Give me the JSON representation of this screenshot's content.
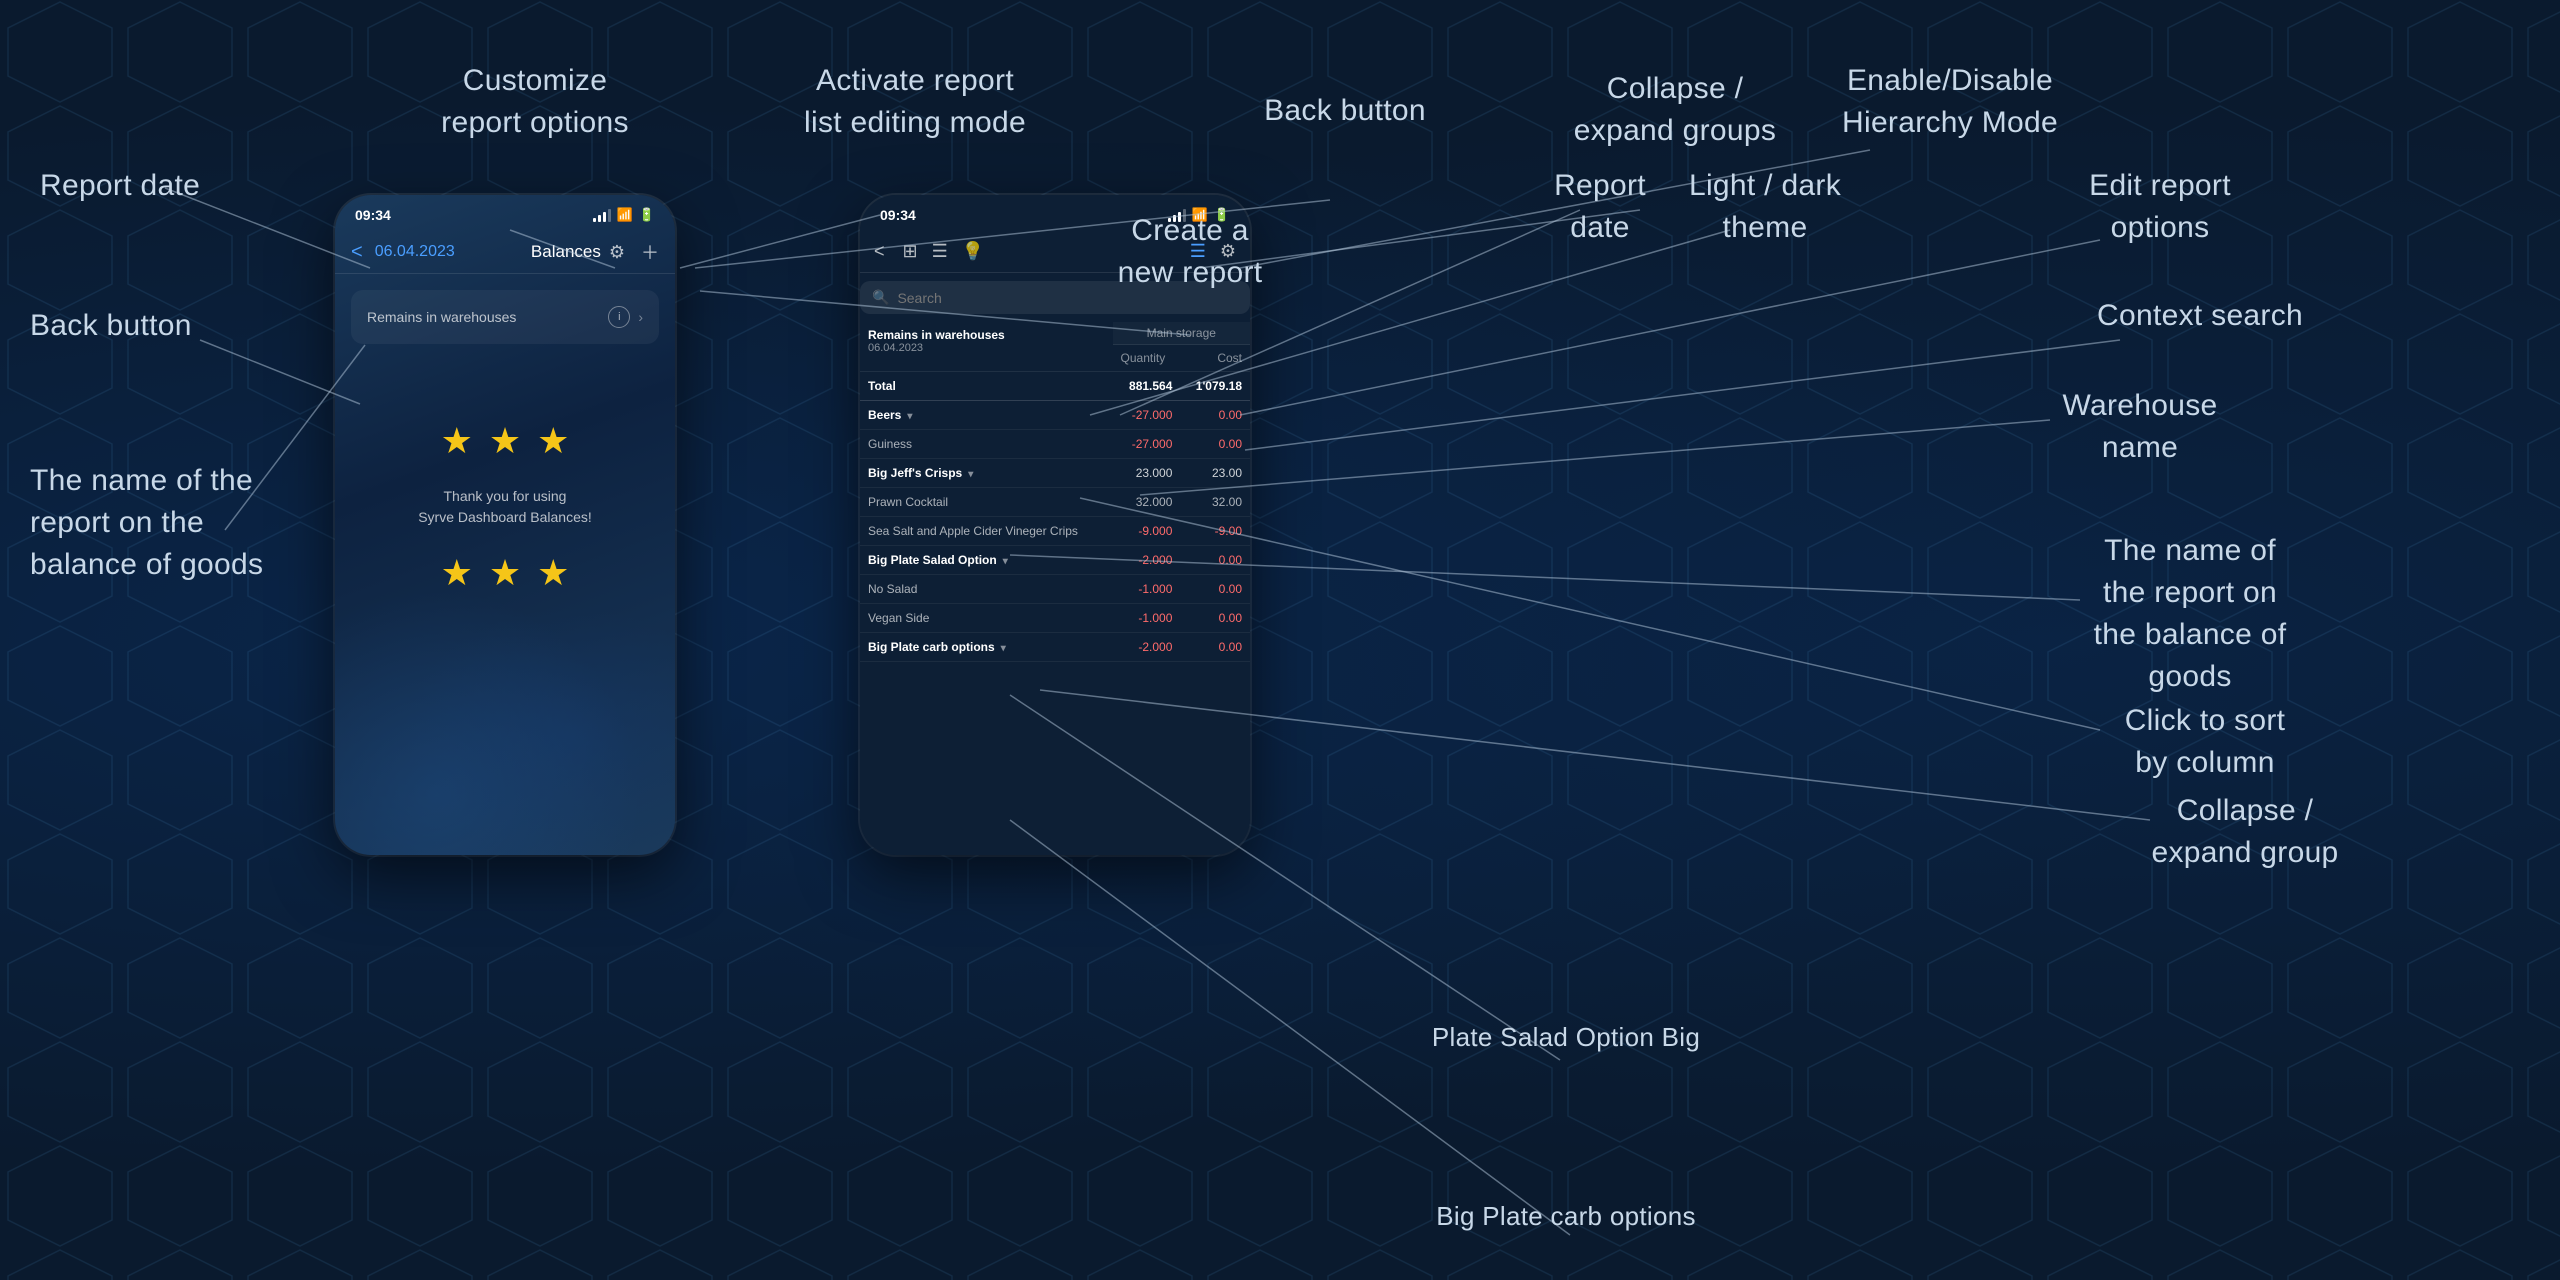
{
  "background": {
    "color": "#0a1a2e"
  },
  "annotations": {
    "customize_report": "Customize\nreport options",
    "activate_edit": "Activate report\nlist editing mode",
    "back_button_top": "Back button",
    "collapse_expand": "Collapse /\nexpand groups",
    "enable_disable": "Enable/Disable\nHierarchy Mode",
    "report_date_left": "Report date",
    "back_button_left": "Back button",
    "create_new": "Create a\nnew report",
    "report_date_right": "Report\ndate",
    "light_dark": "Light / dark\ntheme",
    "edit_report": "Edit report\noptions",
    "the_name_left": "The name of the\nreport on the\nbalance of goods",
    "context_search": "Context search",
    "warehouse_name": "Warehouse\nname",
    "the_name_right": "The name of\nthe report on\nthe balance of\ngoods",
    "click_to_sort": "Click to sort\nby column",
    "collapse_expand_group": "Collapse /\nexpand group"
  },
  "left_phone": {
    "status_time": "09:34",
    "nav_date": "06.04.2023",
    "nav_title": "Balances",
    "report_card_title": "Remains in warehouses",
    "stars1": [
      "★",
      "★",
      "★"
    ],
    "thank_you_line1": "Thank you for using",
    "thank_you_line2": "Syrve Dashboard Balances!",
    "stars2": [
      "★",
      "★",
      "★"
    ]
  },
  "right_phone": {
    "status_time": "09:34",
    "search_placeholder": "Search",
    "table": {
      "warehouse_header": "Main storage",
      "report_title": "Remains in warehouses",
      "report_date": "06.04.2023",
      "col_quantity": "Quantity",
      "col_cost": "Cost",
      "rows": [
        {
          "type": "total",
          "name": "Total",
          "quantity": "881.564",
          "cost": "1'079.18"
        },
        {
          "type": "group",
          "name": "Beers",
          "quantity": "-27.000",
          "cost": "0.00",
          "negative": true
        },
        {
          "type": "sub",
          "name": "Guiness",
          "quantity": "-27.000",
          "cost": "0.00",
          "negative": true
        },
        {
          "type": "group",
          "name": "Big Jeff's Crisps",
          "quantity": "23.000",
          "cost": "23.00"
        },
        {
          "type": "sub",
          "name": "Prawn Cocktail",
          "quantity": "32.000",
          "cost": "32.00"
        },
        {
          "type": "sub",
          "name": "Sea Salt and Apple Cider Vineger Crips",
          "quantity": "-9.000",
          "cost": "-9.00",
          "negative": true
        },
        {
          "type": "group",
          "name": "Big Plate Salad Option",
          "quantity": "-2.000",
          "cost": "0.00",
          "negative": true
        },
        {
          "type": "sub",
          "name": "No Salad",
          "quantity": "-1.000",
          "cost": "0.00",
          "negative": true
        },
        {
          "type": "sub",
          "name": "Vegan Side",
          "quantity": "-1.000",
          "cost": "0.00",
          "negative": true
        },
        {
          "type": "group",
          "name": "Big Plate carb options",
          "quantity": "-2.000",
          "cost": "0.00",
          "negative": true
        }
      ]
    }
  }
}
